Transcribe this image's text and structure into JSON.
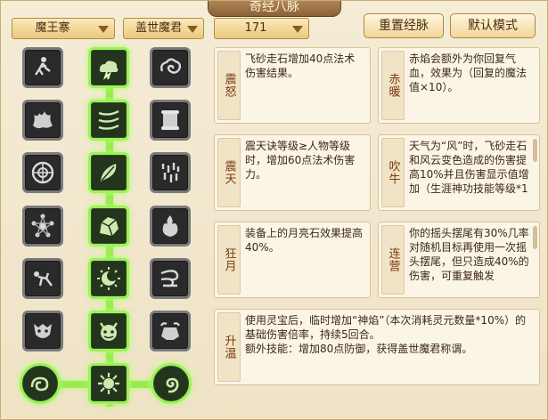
{
  "window": {
    "title": "奇经八脉"
  },
  "toolbar": {
    "faction_select": "魔王寨",
    "character_select": "盖世魔君",
    "level_select": "171",
    "reset_button": "重置经脉",
    "default_button": "默认模式"
  },
  "talents": [
    {
      "name": "震怒",
      "desc": "飞砂走石增加40点法术伤害结果。"
    },
    {
      "name": "赤暖",
      "desc": "赤焰会额外为你回复气血，效果为（回复的魔法值×10）。"
    },
    {
      "name": "震天",
      "desc": "震天诀等级≥人物等级时，增加60点法术伤害力。"
    },
    {
      "name": "吹牛",
      "desc": "天气为“风”时，飞砂走石和风云变色造成的伤害提高10%并且伤害显示值增加（生涯神功技能等级*1"
    },
    {
      "name": "狂月",
      "desc": "装备上的月亮石效果提高40%。"
    },
    {
      "name": "连营",
      "desc": "你的摇头摆尾有30%几率对随机目标再使用一次摇头摆尾，但只造成40%的伤害，可重复触发"
    },
    {
      "name": "升温",
      "desc": "使用灵宝后，临时增加“神焰”（本次消耗灵元数量*10%）的基础伤害倍率，持续5回合。\n额外技能：增加80点防御，获得盖世魔君称谓。"
    }
  ],
  "colors": {
    "active_glow": "#9cf25a",
    "inactive_border": "#7a7a7a",
    "panel_bg": "#fbf5e8",
    "button_bg": "#f1d79a"
  },
  "icons": [
    "running-figure-icon",
    "thunder-cloud-icon",
    "swirl-cloud-icon",
    "flame-burst-icon",
    "crossed-vines-icon",
    "scroll-icon",
    "seal-circle-icon",
    "feather-leaf-icon",
    "rain-drops-icon",
    "star-wheel-icon",
    "boulder-icon",
    "fire-flame-icon",
    "crawling-figure-icon",
    "crescent-sun-icon",
    "wind-spiral-icon",
    "beast-mask-icon",
    "demon-face-icon",
    "charging-ox-icon",
    "dragon-coil-icon",
    "sun-flare-icon",
    "spiral-shell-icon"
  ]
}
